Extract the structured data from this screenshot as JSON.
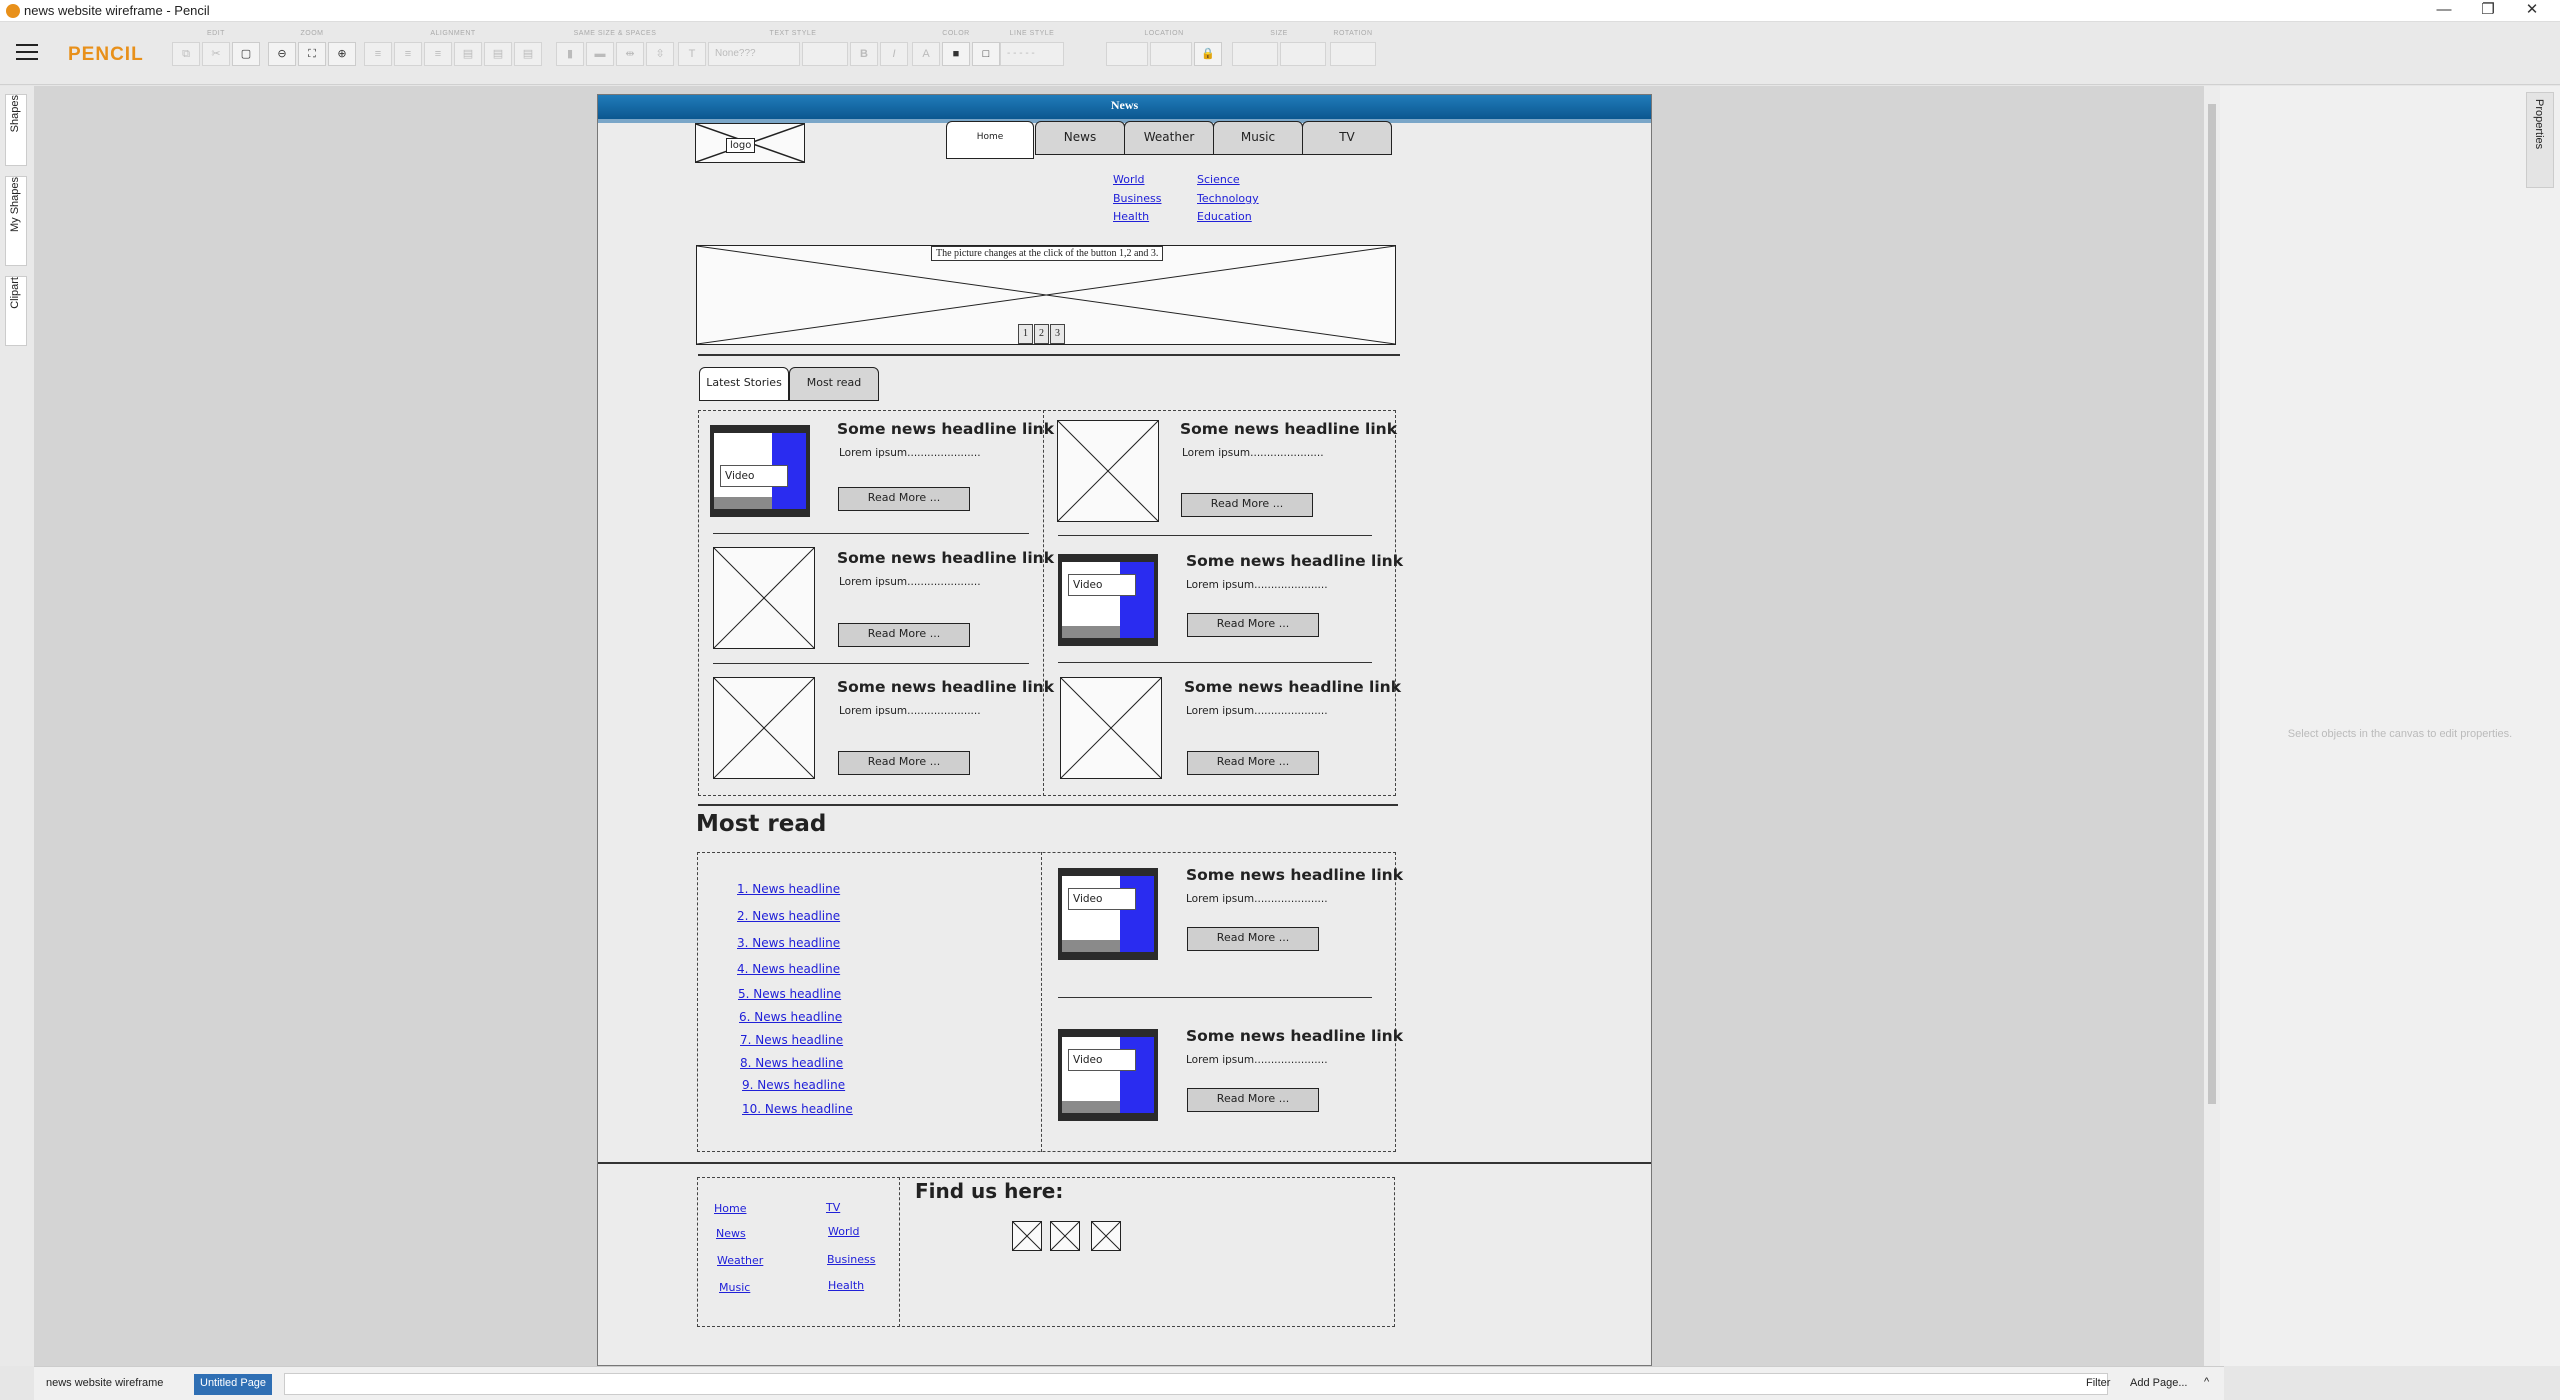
{
  "window": {
    "title": "news website wireframe - Pencil",
    "minimize": "—",
    "restore": "❐",
    "close": "✕"
  },
  "toolbar": {
    "brand": "PENCIL",
    "groups": [
      "EDIT",
      "ZOOM",
      "ALIGNMENT",
      "SAME SIZE & SPACES",
      "TEXT STYLE",
      "COLOR",
      "LINE STYLE",
      "LOCATION",
      "SIZE",
      "ROTATION"
    ],
    "font_field": "None???"
  },
  "left_rail": {
    "tabs": [
      "Shapes",
      "My Shapes",
      "Clipart"
    ]
  },
  "right_panel": {
    "tab": "Properties",
    "hint": "Select objects in the canvas to edit properties."
  },
  "statusbar": {
    "document": "news website wireframe",
    "page_tab": "Untitled Page",
    "filter": "Filter",
    "add_page": "Add Page...",
    "caret": "^"
  },
  "wireframe": {
    "page_title": "News",
    "logo": "logo",
    "nav_tabs": [
      "Home",
      "News",
      "Weather",
      "Music",
      "TV"
    ],
    "sub_links_left": [
      "World",
      "Business",
      "Health"
    ],
    "sub_links_right": [
      "Science",
      "Technology",
      "Education"
    ],
    "banner_tip": "The picture changes at the click of the button 1,2 and 3.",
    "banner_pages": [
      "1",
      "2",
      "3"
    ],
    "story_tabs": [
      "Latest Stories",
      "Most read"
    ],
    "story_headline": "Some news headline link",
    "story_lorem": "Lorem ipsum......................",
    "read_more": "Read More ...",
    "video_label": "Video",
    "most_read_title": "Most read",
    "most_read_links": [
      "1. News headline",
      "2. News headline",
      "3. News headline",
      "4. News headline",
      "5. News headline",
      "6. News headline",
      "7. News headline",
      "8. News headline",
      "9. News headline",
      "10. News headline"
    ],
    "footer_links_left": [
      "Home",
      "News",
      "Weather",
      "Music"
    ],
    "footer_links_right": [
      "TV",
      "World",
      "Business",
      "Health"
    ],
    "find_us": "Find us here:"
  }
}
